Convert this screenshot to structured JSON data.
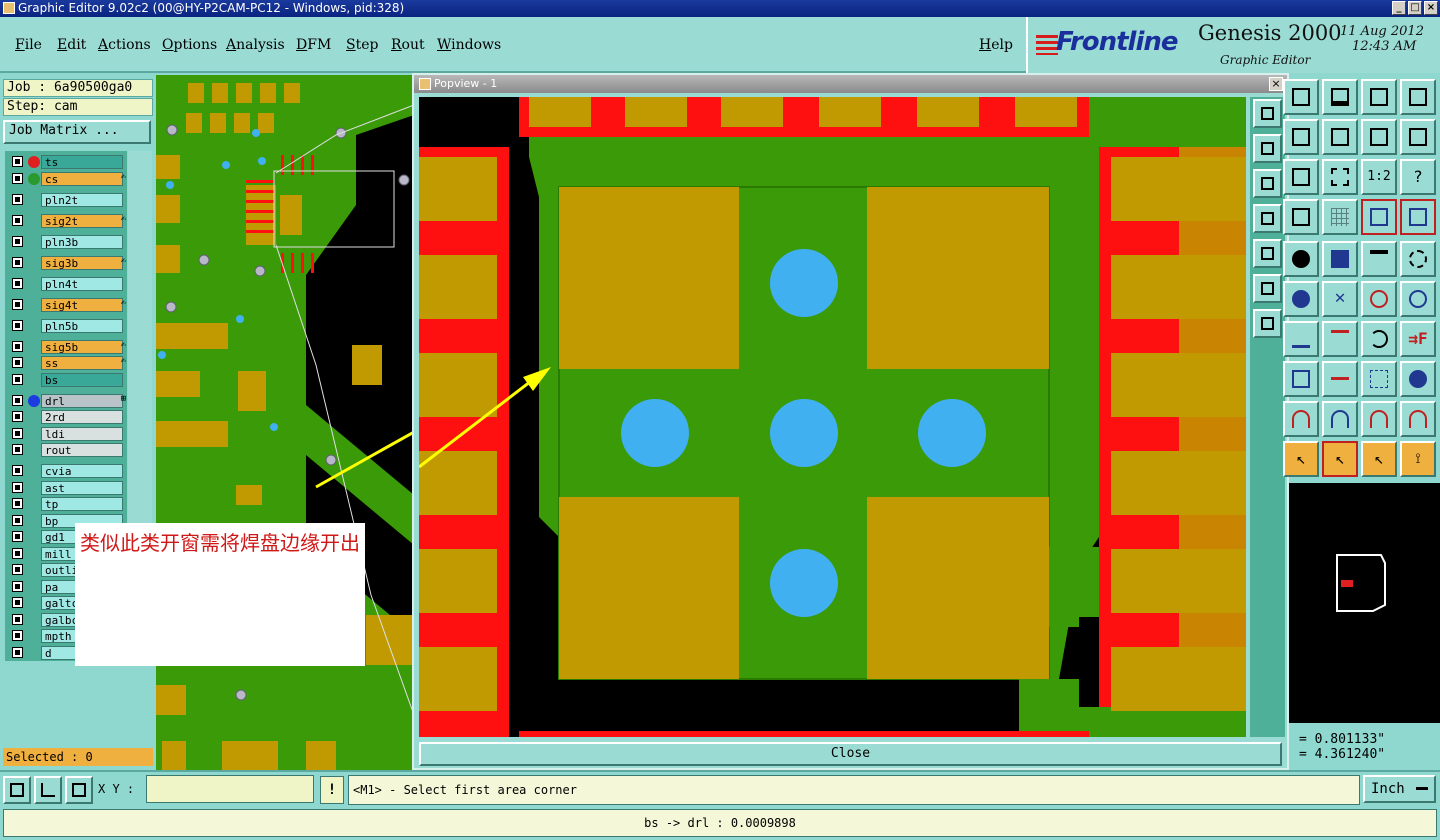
{
  "window": {
    "title": "Graphic Editor 9.02c2 (00@HY-P2CAM-PC12 - Windows, pid:328)"
  },
  "menu": [
    "File",
    "Edit",
    "Actions",
    "Options",
    "Analysis",
    "DFM",
    "Step",
    "Rout",
    "Windows"
  ],
  "help_label": "Help",
  "brand": {
    "logo": "Frontline",
    "product": "Genesis 2000",
    "subtitle": "Graphic Editor",
    "date": "11 Aug 2012",
    "time": "12:43 AM"
  },
  "job": {
    "job_label": "Job : 6a90500ga0",
    "step_label": "Step: cam",
    "matrix_button": "Job Matrix ..."
  },
  "layers": [
    {
      "name": "ts",
      "style": "teal",
      "dot": "#e02020",
      "mark": ""
    },
    {
      "name": "cs",
      "style": "orange",
      "dot": "#2a9a30",
      "mark": "✍"
    },
    {
      "name": "pln2t",
      "style": "cyan",
      "dot": "",
      "mark": ""
    },
    {
      "name": "sig2t",
      "style": "orange",
      "dot": "",
      "mark": "✍"
    },
    {
      "name": "pln3b",
      "style": "cyan",
      "dot": "",
      "mark": ""
    },
    {
      "name": "sig3b",
      "style": "orange",
      "dot": "",
      "mark": "✍"
    },
    {
      "name": "pln4t",
      "style": "cyan",
      "dot": "",
      "mark": ""
    },
    {
      "name": "sig4t",
      "style": "orange",
      "dot": "",
      "mark": "✍"
    },
    {
      "name": "pln5b",
      "style": "cyan",
      "dot": "",
      "mark": ""
    },
    {
      "name": "sig5b",
      "style": "orange",
      "dot": "",
      "mark": "✍"
    },
    {
      "name": "ss",
      "style": "orange",
      "dot": "",
      "mark": "✍"
    },
    {
      "name": "bs",
      "style": "teal",
      "dot": "",
      "mark": ""
    },
    {
      "name": "drl",
      "style": "grey",
      "dot": "#1c3ce0",
      "mark": "⊞"
    },
    {
      "name": "2rd",
      "style": "lgrey",
      "dot": "",
      "mark": ""
    },
    {
      "name": "ldi",
      "style": "lgrey",
      "dot": "",
      "mark": ""
    },
    {
      "name": "rout",
      "style": "lgrey",
      "dot": "",
      "mark": ""
    },
    {
      "name": "cvia",
      "style": "cyan",
      "dot": "",
      "mark": ""
    },
    {
      "name": "ast",
      "style": "cyan",
      "dot": "",
      "mark": ""
    },
    {
      "name": "tp",
      "style": "cyan",
      "dot": "",
      "mark": ""
    },
    {
      "name": "bp",
      "style": "cyan",
      "dot": "",
      "mark": ""
    },
    {
      "name": "gd1",
      "style": "cyan",
      "dot": "",
      "mark": ""
    },
    {
      "name": "mill",
      "style": "cyan",
      "dot": "",
      "mark": ""
    },
    {
      "name": "outli",
      "style": "cyan",
      "dot": "",
      "mark": ""
    },
    {
      "name": "pa",
      "style": "cyan",
      "dot": "",
      "mark": ""
    },
    {
      "name": "galtc",
      "style": "cyan",
      "dot": "",
      "mark": ""
    },
    {
      "name": "galbc",
      "style": "cyan",
      "dot": "",
      "mark": ""
    },
    {
      "name": "mpth",
      "style": "cyan",
      "dot": "",
      "mark": ""
    },
    {
      "name": "d",
      "style": "cyan",
      "dot": "",
      "mark": ""
    }
  ],
  "selected_label": "Selected : 0",
  "popview": {
    "title": "Popview - 1",
    "close_label": "Close"
  },
  "annotation": "类似此类开窗需将焊盘边缘开出",
  "coords": {
    "x": "= 0.801133\"",
    "y": "= 4.361240\""
  },
  "cmd": {
    "xy_label": "X Y :",
    "xy_value": "",
    "bang": "!",
    "prompt": "<M1> - Select first area corner",
    "unit": "Inch"
  },
  "status": "bs -> drl : 0.0009898",
  "colors": {
    "pad": "#c09a00",
    "copper": "#3a9a08",
    "mask": "#ff1010",
    "drill": "#40b0f0",
    "arrow": "#ffff00"
  }
}
